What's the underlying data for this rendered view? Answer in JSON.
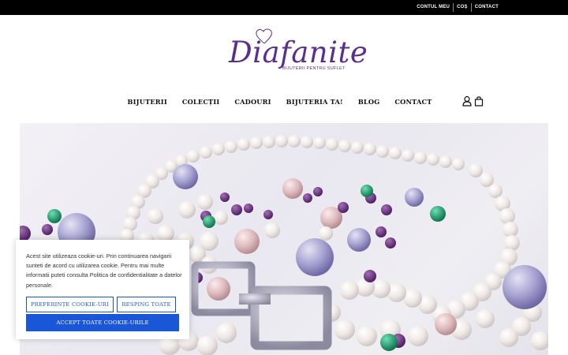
{
  "topbar": {
    "links": [
      "CONTUL MEU",
      "COȘ",
      "CONTACT"
    ]
  },
  "logo": {
    "name": "Diafanite",
    "tagline": "BIJUTERII PENTRU SUFLET"
  },
  "nav": {
    "items": [
      "BIJUTERII",
      "COLECȚII",
      "CADOURI",
      "BIJUTERIA TA!",
      "BLOG",
      "CONTACT"
    ],
    "icons": [
      "user-icon",
      "cart-icon"
    ]
  },
  "cookie": {
    "text": "Acest site utilizeaza cookie-uri. Prin continuarea navigarii sunteti de acord cu utilizarea cookie. Pentru mai multe informatii puteti consulta Politica de confidentialitate a datelor personale.",
    "preferences_label": "PREFERINȚE COOKIE-URI",
    "reject_label": "RESPING TOATE",
    "accept_label": "ACCEPT TOATE COOKIE-URILE"
  },
  "colors": {
    "brand_purple": "#5a2d91",
    "accent_blue": "#1a56d8",
    "topbar": "#000000"
  }
}
